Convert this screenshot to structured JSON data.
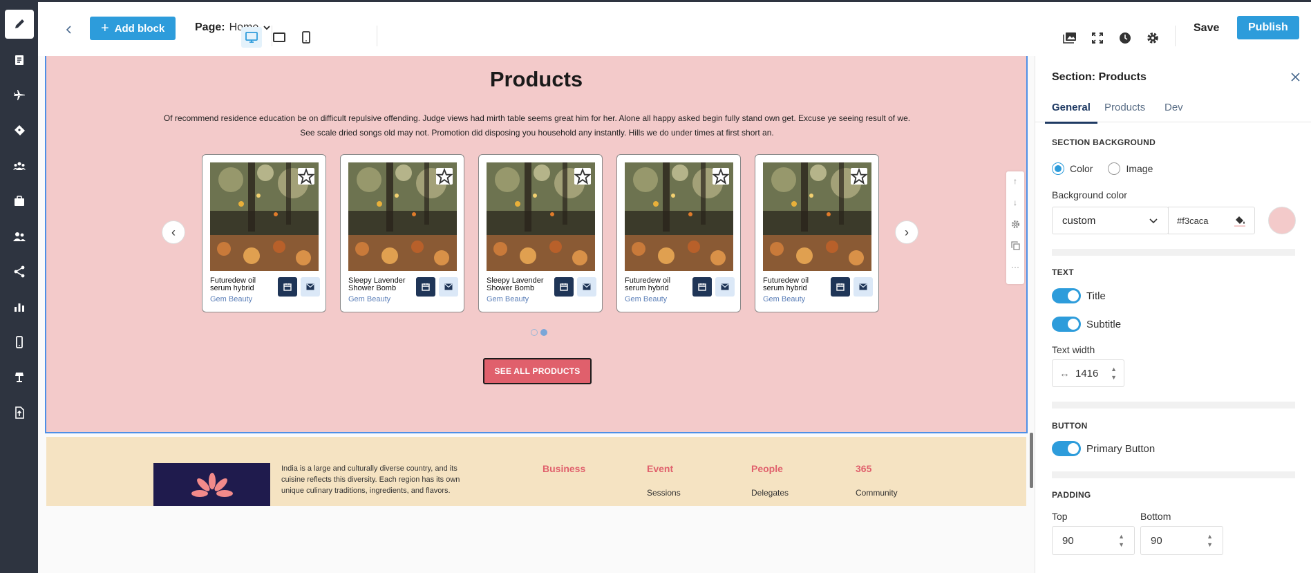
{
  "toolbar": {
    "add_block_label": "Add block",
    "page_label": "Page:",
    "page_value": "Home",
    "save_label": "Save",
    "publish_label": "Publish"
  },
  "products": {
    "title": "Products",
    "subtitle": "Of recommend residence education be on difficult repulsive offending. Judge views had mirth table seems great him for her. Alone all happy asked begin fully stand own get. Excuse ye seeing result of we. See scale dried songs old may not. Promotion did disposing you household any instantly. Hills we do under times at first short an.",
    "cards": [
      {
        "name": "Futuredew oil serum hybrid",
        "brand": "Gem Beauty"
      },
      {
        "name": "Sleepy Lavender Shower Bomb",
        "brand": "Gem Beauty"
      },
      {
        "name": "Sleepy Lavender Shower Bomb",
        "brand": "Gem Beauty"
      },
      {
        "name": "Futuredew oil serum hybrid",
        "brand": "Gem Beauty"
      },
      {
        "name": "Futuredew oil serum hybrid",
        "brand": "Gem Beauty"
      }
    ],
    "carousel_pages": 2,
    "carousel_active": 2,
    "see_all_label": "SEE ALL PRODUCTS"
  },
  "footer": {
    "text": "India is a large and culturally diverse country, and its cuisine reflects this diversity. Each region has its own unique culinary traditions, ingredients, and flavors.",
    "columns": [
      {
        "heading": "Business",
        "link": ""
      },
      {
        "heading": "Event",
        "link": "Sessions"
      },
      {
        "heading": "People",
        "link": "Delegates"
      },
      {
        "heading": "365",
        "link": "Community"
      }
    ]
  },
  "panel": {
    "title": "Section: Products",
    "tabs": [
      "General",
      "Products",
      "Dev"
    ],
    "section_background": "SECTION BACKGROUND",
    "bg_options": [
      "Color",
      "Image"
    ],
    "bg_color_label": "Background color",
    "bg_color_mode": "custom",
    "bg_color_value": "#f3caca",
    "text_group": "TEXT",
    "toggle_title": "Title",
    "toggle_subtitle": "Subtitle",
    "text_width_label": "Text width",
    "text_width_value": "1416",
    "button_group": "BUTTON",
    "toggle_primary_button": "Primary Button",
    "padding_group": "PADDING",
    "padding_top_label": "Top",
    "padding_bottom_label": "Bottom",
    "padding_top_value": "90",
    "padding_bottom_value": "90"
  },
  "colors": {
    "accent": "#2d9cdb",
    "rail": "#2e3440",
    "products_bg": "#f3caca",
    "cta": "#e0606c",
    "footer_bg": "#f5e3c2",
    "selection_outline": "#4d8fe6"
  }
}
